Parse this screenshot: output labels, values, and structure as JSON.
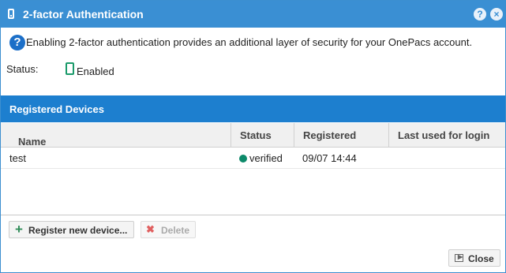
{
  "dialog": {
    "title": "2-factor Authentication",
    "help_glyph": "?",
    "close_glyph": "×"
  },
  "info": {
    "text": "Enabling 2-factor authentication provides an additional layer of security for your OnePacs account."
  },
  "status": {
    "label": "Status:",
    "value": "Enabled"
  },
  "panel": {
    "title": "Registered Devices"
  },
  "grid": {
    "columns": [
      "Name",
      "Status",
      "Registered",
      "Last used for login"
    ],
    "sort_indicator": "↑",
    "rows": [
      {
        "name": "test",
        "status": "verified",
        "registered": "09/07 14:44",
        "last_used": ""
      }
    ]
  },
  "buttons": {
    "register": "Register new device...",
    "delete": "Delete",
    "close": "Close"
  },
  "colors": {
    "titlebar": "#3a8fd3",
    "panel_header": "#1d7fcf",
    "verified_dot": "#0d8a6a",
    "phone_icon": "#1a9a6a"
  }
}
